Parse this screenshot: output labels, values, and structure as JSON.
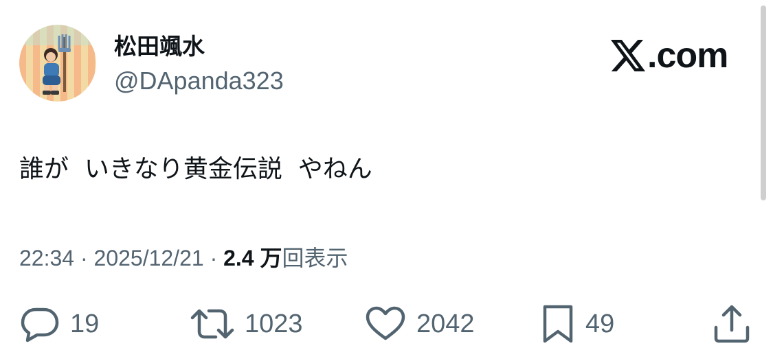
{
  "user": {
    "display_name": "松田颯水",
    "handle": "@DApanda323"
  },
  "brand": {
    "text": ".com",
    "logo_icon": "x-logo-icon"
  },
  "tweet": {
    "text": "誰が  いきなり黄金伝説  やねん"
  },
  "meta": {
    "time": "22:34",
    "sep1": " · ",
    "date": "2025/12/21",
    "sep2": " · ",
    "views_count": "2.4 万",
    "views_label": "回表示"
  },
  "actions": {
    "reply": {
      "icon": "reply-icon",
      "count": "19"
    },
    "repost": {
      "icon": "repost-icon",
      "count": "1023"
    },
    "like": {
      "icon": "heart-icon",
      "count": "2042"
    },
    "bookmark": {
      "icon": "bookmark-icon",
      "count": "49"
    },
    "share": {
      "icon": "share-icon"
    }
  },
  "colors": {
    "text_primary": "#0f1419",
    "text_secondary": "#536471",
    "background": "#ffffff"
  }
}
